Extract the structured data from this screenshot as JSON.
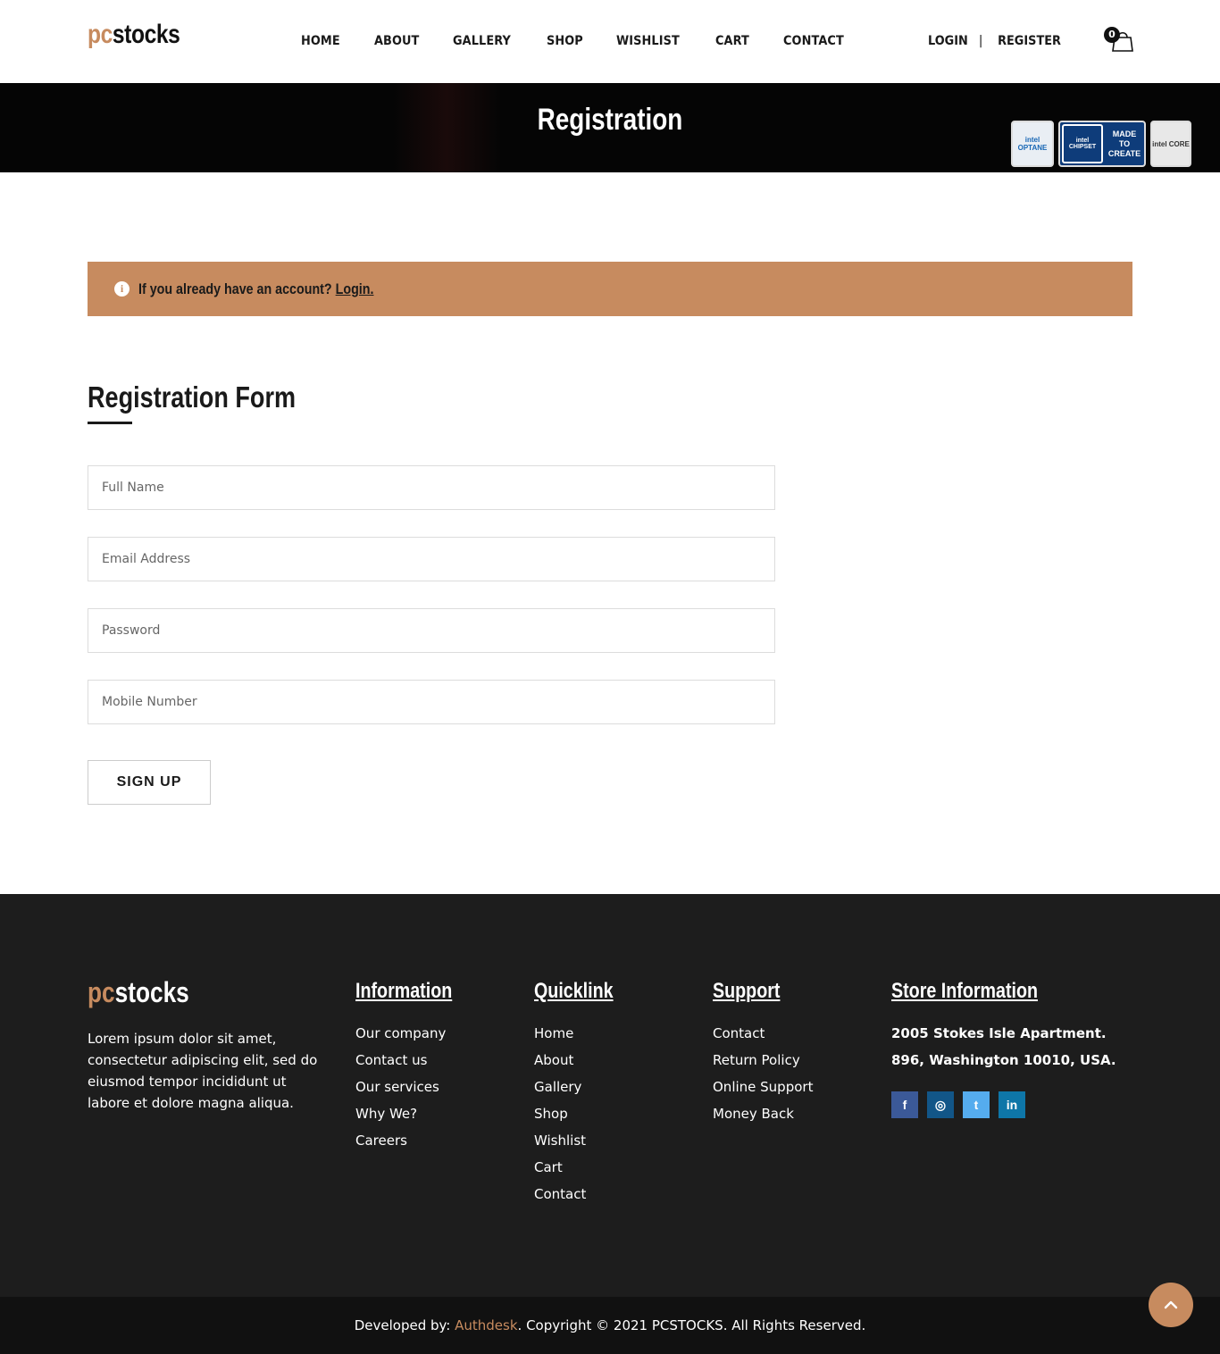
{
  "brand": {
    "prefix": "pc",
    "name": "stocks",
    "accent": "#c78b5f"
  },
  "nav": {
    "items": [
      "HOME",
      "ABOUT",
      "GALLERY",
      "SHOP",
      "WISHLIST",
      "CART",
      "CONTACT"
    ],
    "login": "LOGIN",
    "separator": "|",
    "register": "REGISTER",
    "cart_count": "0"
  },
  "banner": {
    "title": "Registration",
    "badges": [
      "intel OPTANE",
      "intel CHIPSET",
      "MADE TO CREATE",
      "intel CORE"
    ]
  },
  "alert": {
    "text": "If you already have an account?",
    "link": "Login."
  },
  "form": {
    "title": "Registration Form",
    "fields": {
      "full_name": "Full Name",
      "email": "Email Address",
      "password": "Password",
      "mobile": "Mobile Number"
    },
    "submit": "SIGN UP"
  },
  "footer": {
    "about": "Lorem ipsum dolor sit amet, consectetur adipiscing elit, sed do eiusmod tempor incididunt ut labore et dolore magna aliqua.",
    "information": {
      "title": "Information",
      "links": [
        "Our company",
        "Contact us",
        "Our services",
        "Why We?",
        "Careers"
      ]
    },
    "quicklink": {
      "title": "Quicklink",
      "links": [
        "Home",
        "About",
        "Gallery",
        "Shop",
        "Wishlist",
        "Cart",
        "Contact"
      ]
    },
    "support": {
      "title": "Support",
      "links": [
        "Contact",
        "Return Policy",
        "Online Support",
        "Money Back"
      ]
    },
    "store": {
      "title": "Store Information",
      "address": "2005 Stokes Isle Apartment. 896, Washington 10010, USA.",
      "socials": [
        {
          "icon": "facebook-icon",
          "glyph": "f",
          "color": "#3b5998"
        },
        {
          "icon": "instagram-icon",
          "glyph": "◎",
          "color": "#125688"
        },
        {
          "icon": "twitter-icon",
          "glyph": "t",
          "color": "#55acee"
        },
        {
          "icon": "linkedin-icon",
          "glyph": "in",
          "color": "#0e76a8"
        }
      ]
    }
  },
  "copyright": {
    "prefix": "Developed by: ",
    "developer": "Authdesk",
    "suffix": ". Copyright © 2021 PCSTOCKS. All Rights Reserved."
  }
}
